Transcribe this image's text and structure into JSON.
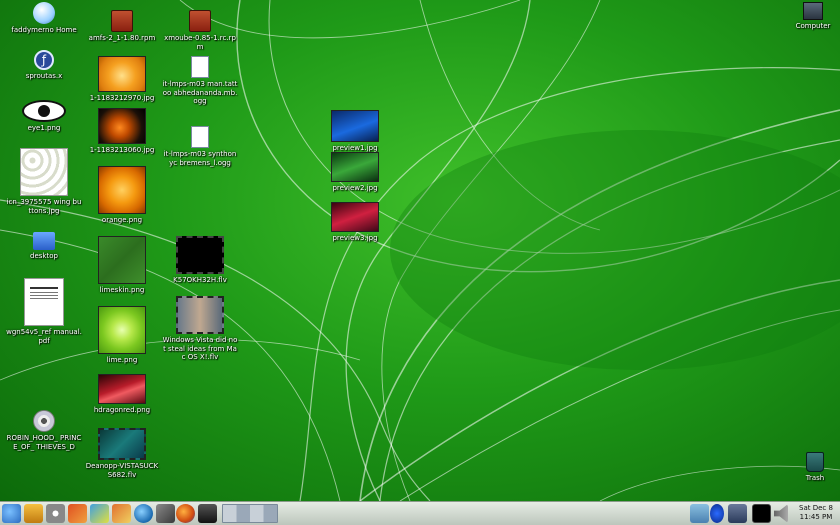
{
  "desktop": {
    "icons": [
      {
        "label": "faddymerno Home"
      },
      {
        "label": "sproutas.x"
      },
      {
        "label": "eye1.png"
      },
      {
        "label": "icn_3975575 wing buttons.jpg"
      },
      {
        "label": "desktop"
      },
      {
        "label": "wgn54v5_ref manual.pdf"
      },
      {
        "label": "ROBIN_HOOD_ PRINCE_OF_ THIEVES_D"
      },
      {
        "label": "amfs-2_1-1.80.rpm"
      },
      {
        "label": "1-1183212970.jpg"
      },
      {
        "label": "1-1183213060.jpg"
      },
      {
        "label": "orange.png"
      },
      {
        "label": "limeskin.png"
      },
      {
        "label": "lime.png"
      },
      {
        "label": "hdragonred.png"
      },
      {
        "label": "Deanopp-VISTASUCKS682.flv"
      },
      {
        "label": "xmoube-0.85-1.rc.rpm"
      },
      {
        "label": "it-lmps-m03 man.tattoo abhedananda.mb.ogg"
      },
      {
        "label": "it-lmps-m03 synthonyc bremens_l.ogg"
      },
      {
        "label": "K57OKH32H.flv"
      },
      {
        "label": "Windows Vista did not steal ideas from Mac OS X!.flv"
      },
      {
        "label": "preview1.jpg"
      },
      {
        "label": "preview2.jpg"
      },
      {
        "label": "preview3.jpg"
      },
      {
        "label": "Computer"
      },
      {
        "label": "Trash"
      }
    ]
  },
  "taskbar": {
    "clock": {
      "day": "Sat Dec 8",
      "time": "11:45 PM"
    }
  }
}
